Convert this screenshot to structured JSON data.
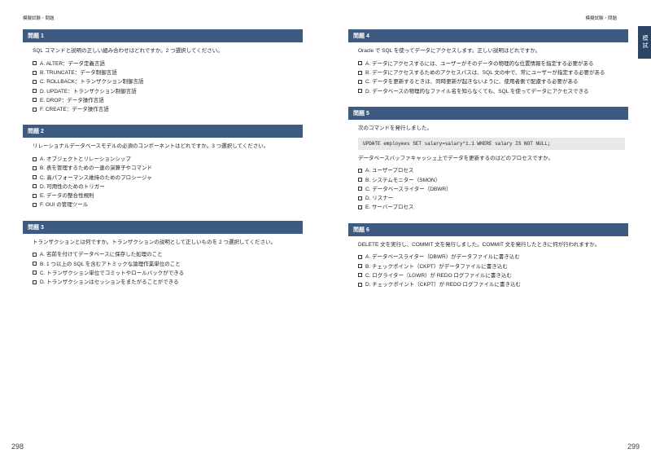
{
  "header_text": "模擬試験・問題",
  "side_tab": "模試",
  "page_left_num": "298",
  "page_right_num": "299",
  "left": {
    "q1": {
      "title": "問題 1",
      "prompt": "SQL コマンドと説明の正しい組み合わせはどれですか。2 つ選択してください。",
      "opts": [
        "A. ALTER：データ定義言語",
        "B. TRUNCATE：データ制御言語",
        "C. ROLLBACK：トランザクション制御言語",
        "D. UPDATE：トランザクション制御言語",
        "E. DROP：データ操作言語",
        "F. CREATE：データ操作言語"
      ]
    },
    "q2": {
      "title": "問題 2",
      "prompt": "リレーショナルデータベースモデルの必須のコンポーネントはどれですか。3 つ選択してください。",
      "opts": [
        "A. オブジェクトとリレーションシップ",
        "B. 表を管理するための一連の演算子やコマンド",
        "C. 高パフォーマンス維持のためのプロシージャ",
        "D. 可用性のためのトリガー",
        "E. データの整合性規則",
        "F. GUI の管理ツール"
      ]
    },
    "q3": {
      "title": "問題 3",
      "prompt": "トランザクションとは何ですか。トランザクションの説明として正しいものを 2 つ選択してください。",
      "opts": [
        "A. 名前を付けてデータベースに保存した処理のこと",
        "B. 1 つ以上の SQL を含むアトミックな論理作業単位のこと",
        "C. トランザクション単位でコミットやロールバックができる",
        "D. トランザクションはセッションをまたがることができる"
      ]
    }
  },
  "right": {
    "q4": {
      "title": "問題 4",
      "prompt": "Oracle で SQL を使ってデータにアクセスします。正しい説明はどれですか。",
      "opts": [
        "A. データにアクセスするには、ユーザーがそのデータの物理的な位置情報を指定する必要がある",
        "B. データにアクセスするためのアクセスパスは、SQL 文の中で、常にユーザーが指定する必要がある",
        "C. データを更新するときは、同時更新が起きないように、使用者側で配慮する必要がある",
        "D. データベースの物理的なファイル名を知らなくても、SQL を使ってデータにアクセスできる"
      ]
    },
    "q5": {
      "title": "問題 5",
      "prompt": "次のコマンドを発行しました。",
      "code": "UPDATE employees SET salary=salary*1.1 WHERE salary IS NOT NULL;",
      "sub_prompt": "データベースバッファキャッシュ上でデータを更新するのはどのプロセスですか。",
      "opts": [
        "A. ユーザープロセス",
        "B. システムモニター（SMON）",
        "C. データベースライター（DBWR）",
        "D. リスナー",
        "E. サーバープロセス"
      ]
    },
    "q6": {
      "title": "問題 6",
      "prompt": "DELETE 文を実行し、COMMIT 文を発行しました。COMMIT 文を発行したときに何が行われますか。",
      "opts": [
        "A. データベースライター（DBWR）がデータファイルに書き込む",
        "B. チェックポイント（CKPT）がデータファイルに書き込む",
        "C. ログライター（LGWR）が REDO ログファイルに書き込む",
        "D. チェックポイント（CKPT）が REDO ログファイルに書き込む"
      ]
    }
  }
}
